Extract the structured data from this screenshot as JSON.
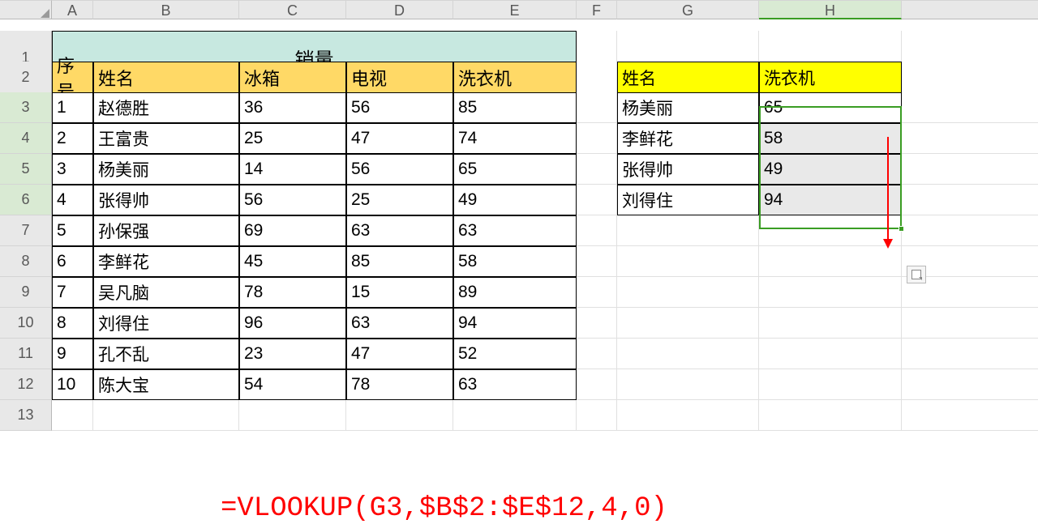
{
  "columns": [
    "A",
    "B",
    "C",
    "D",
    "E",
    "F",
    "G",
    "H"
  ],
  "rows_visible": 13,
  "merged_title": "销量",
  "main_table": {
    "headers": [
      "序号",
      "姓名",
      "冰箱",
      "电视",
      "洗衣机"
    ],
    "rows": [
      [
        "1",
        "赵德胜",
        "36",
        "56",
        "85"
      ],
      [
        "2",
        "王富贵",
        "25",
        "47",
        "74"
      ],
      [
        "3",
        "杨美丽",
        "14",
        "56",
        "65"
      ],
      [
        "4",
        "张得帅",
        "56",
        "25",
        "49"
      ],
      [
        "5",
        "孙保强",
        "69",
        "63",
        "63"
      ],
      [
        "6",
        "李鲜花",
        "45",
        "85",
        "58"
      ],
      [
        "7",
        "吴凡脑",
        "78",
        "15",
        "89"
      ],
      [
        "8",
        "刘得住",
        "96",
        "63",
        "94"
      ],
      [
        "9",
        "孔不乱",
        "23",
        "47",
        "52"
      ],
      [
        "10",
        "陈大宝",
        "54",
        "78",
        "63"
      ]
    ]
  },
  "side_table": {
    "headers": [
      "姓名",
      "洗衣机"
    ],
    "rows": [
      [
        "杨美丽",
        "65"
      ],
      [
        "李鲜花",
        "58"
      ],
      [
        "张得帅",
        "49"
      ],
      [
        "刘得住",
        "94"
      ]
    ]
  },
  "formula": "=VLOOKUP(G3,$B$2:$E$12,4,0)",
  "chart_data": {
    "type": "table",
    "title": "销量",
    "columns": [
      "序号",
      "姓名",
      "冰箱",
      "电视",
      "洗衣机"
    ],
    "rows": [
      [
        1,
        "赵德胜",
        36,
        56,
        85
      ],
      [
        2,
        "王富贵",
        25,
        47,
        74
      ],
      [
        3,
        "杨美丽",
        14,
        56,
        65
      ],
      [
        4,
        "张得帅",
        56,
        25,
        49
      ],
      [
        5,
        "孙保强",
        69,
        63,
        63
      ],
      [
        6,
        "李鲜花",
        45,
        85,
        58
      ],
      [
        7,
        "吴凡脑",
        78,
        15,
        89
      ],
      [
        8,
        "刘得住",
        96,
        63,
        94
      ],
      [
        9,
        "孔不乱",
        23,
        47,
        52
      ],
      [
        10,
        "陈大宝",
        54,
        78,
        63
      ]
    ],
    "lookup": {
      "formula": "=VLOOKUP(G3,$B$2:$E$12,4,0)",
      "columns": [
        "姓名",
        "洗衣机"
      ],
      "rows": [
        [
          "杨美丽",
          65
        ],
        [
          "李鲜花",
          58
        ],
        [
          "张得帅",
          49
        ],
        [
          "刘得住",
          94
        ]
      ]
    }
  }
}
